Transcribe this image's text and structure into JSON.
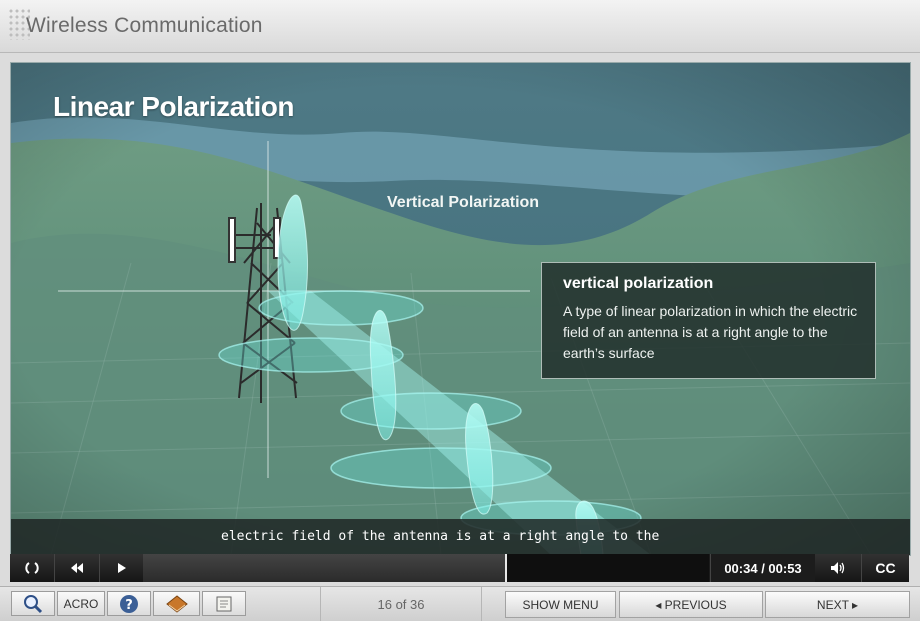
{
  "app": {
    "title": "Wireless Communication"
  },
  "slide": {
    "title": "Linear Polarization",
    "diagram_label": "Vertical Polarization",
    "definition": {
      "term": "vertical polarization",
      "text": "A type of linear polarization in which the electric field of an antenna is at a right angle to the earth’s surface"
    },
    "caption": "electric field of the antenna is at a right angle to the"
  },
  "player": {
    "replay_icon": "replay-icon",
    "rewind_icon": "rewind-icon",
    "play_icon": "play-icon",
    "time": "00:34 / 00:53",
    "progress": 0.64,
    "volume_icon": "volume-icon",
    "cc_label": "CC"
  },
  "toolbar": {
    "glossary_icon": "magnifier-icon",
    "acro_label": "ACRO",
    "help_icon": "help-icon",
    "resources_icon": "book-icon",
    "transcript_icon": "scroll-icon"
  },
  "nav": {
    "page_indicator": "16 of 36",
    "show_menu": "SHOW MENU",
    "previous": "◂ PREVIOUS",
    "next": "NEXT ▸"
  }
}
